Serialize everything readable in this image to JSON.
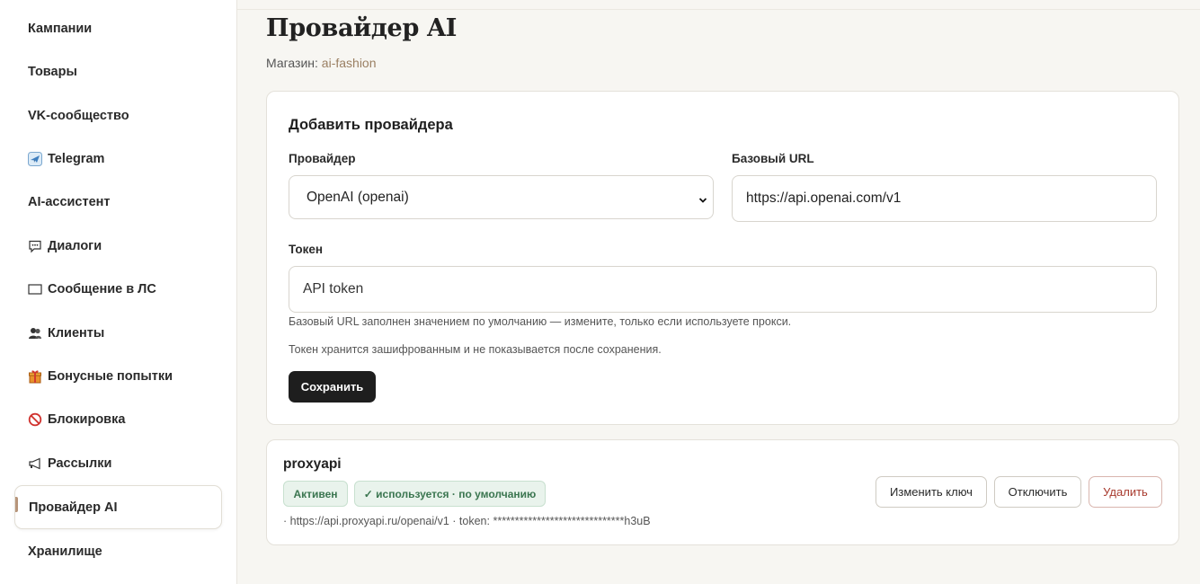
{
  "sidebar": {
    "items": [
      {
        "label": "Кампании",
        "icon": ""
      },
      {
        "label": "Товары",
        "icon": ""
      },
      {
        "label": "VK-сообщество",
        "icon": ""
      },
      {
        "label": "Telegram",
        "icon": "airplane-icon"
      },
      {
        "label": "AI-ассистент",
        "icon": ""
      },
      {
        "label": "Диалоги",
        "icon": "speech-bubble-icon"
      },
      {
        "label": "Сообщение в ЛС",
        "icon": "envelope-icon"
      },
      {
        "label": "Клиенты",
        "icon": "users-icon"
      },
      {
        "label": "Бонусные попытки",
        "icon": "gift-icon"
      },
      {
        "label": "Блокировка",
        "icon": "prohibited-icon"
      },
      {
        "label": "Рассылки",
        "icon": "megaphone-icon"
      },
      {
        "label": "Провайдер AI",
        "icon": "",
        "active": true
      },
      {
        "label": "Хранилище",
        "icon": ""
      }
    ]
  },
  "page": {
    "title": "Провайдер AI",
    "store_label": "Магазин:",
    "store_name": "ai-fashion"
  },
  "add_form": {
    "title": "Добавить провайдера",
    "provider_label": "Провайдер",
    "provider_value": "OpenAI (openai)",
    "base_url_label": "Базовый URL",
    "base_url_value": "https://api.openai.com/v1",
    "token_label": "Токен",
    "token_placeholder": "API token",
    "hint_url": "Базовый URL заполнен значением по умолчанию — измените, только если используете прокси.",
    "hint_token": "Токен хранится зашифрованным и не показывается после сохранения.",
    "save_label": "Сохранить"
  },
  "provider_card": {
    "name": "proxyapi",
    "badge_active": "Активен",
    "badge_default": "✓ используется · по умолчанию",
    "meta": "· https://api.proxyapi.ru/openai/v1 · token: ******************************h3uB",
    "change_key_label": "Изменить ключ",
    "disable_label": "Отключить",
    "delete_label": "Удалить"
  },
  "colors": {
    "accent": "#b7957a",
    "primary_button": "#1e1e1e",
    "badge_green_bg": "#e9f3ec",
    "badge_green_text": "#3b7650",
    "danger": "#a83a2e"
  }
}
